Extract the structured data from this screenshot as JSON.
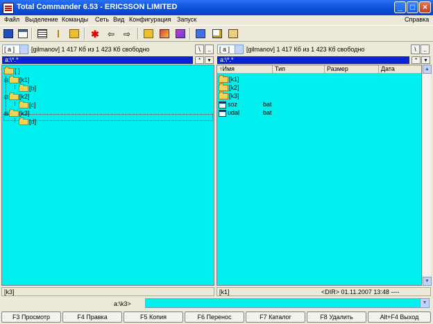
{
  "window": {
    "title": "Total Commander 6.53 - ERICSSON LIMITED"
  },
  "menu": {
    "left": [
      "Файл",
      "Выделение",
      "Команды",
      "Сеть",
      "Вид",
      "Конфигурация",
      "Запуск"
    ],
    "right": "Справка"
  },
  "toolbar": {
    "icons": [
      "refresh-icon",
      "brief-view-icon",
      "full-view-icon",
      "tree-view-icon",
      "sort-icon",
      "invert-selection-icon",
      "back-icon",
      "forward-icon",
      "pack-icon",
      "unpack-icon",
      "find-icon",
      "ftp-icon",
      "notepad-icon",
      "view-icon"
    ]
  },
  "left_panel": {
    "drive": "[ a ]",
    "drive_info": "[gilmanov]  1 417 Кб из 1 423 Кб свободно",
    "root_btn": "\\",
    "up_btn": "..",
    "path": "a:\\*.*",
    "tree": [
      {
        "label": "[ ]",
        "level": 0
      },
      {
        "label": "[k1]",
        "level": 1
      },
      {
        "label": "[b]",
        "level": 2
      },
      {
        "label": "[k2]",
        "level": 1
      },
      {
        "label": "[c]",
        "level": 2
      },
      {
        "label": "[k3]",
        "level": 1
      },
      {
        "label": "[d]",
        "level": 2
      }
    ],
    "status": "[k3]"
  },
  "right_panel": {
    "drive": "[ a ]",
    "drive_info": "[gilmanov]  1 417 Кб из 1 423 Кб свободно",
    "root_btn": "\\",
    "up_btn": "..",
    "path": "a:\\*.*",
    "columns": [
      "↑Имя",
      "Тип",
      "Размер",
      "Дата"
    ],
    "files": [
      {
        "name": "[k1]",
        "ext": "",
        "type": "folder"
      },
      {
        "name": "[k2]",
        "ext": "",
        "type": "folder"
      },
      {
        "name": "[k3]",
        "ext": "",
        "type": "folder"
      },
      {
        "name": "soz",
        "ext": "bat",
        "type": "file"
      },
      {
        "name": "udal",
        "ext": "bat",
        "type": "file"
      }
    ],
    "status_name": "[k1]",
    "status_info": "<DIR>    01.11.2007 13:48 ----"
  },
  "command_line": {
    "label": "a:\\k3>",
    "value": ""
  },
  "fkeys": [
    "F3 Просмотр",
    "F4 Правка",
    "F5 Копия",
    "F6 Перенос",
    "F7 Каталог",
    "F8 Удалить",
    "Alt+F4 Выход"
  ],
  "colors": {
    "panel_bg": "#00f0f0",
    "path_bg": "#0a24d0",
    "title_bg": "#0a4fd8"
  }
}
